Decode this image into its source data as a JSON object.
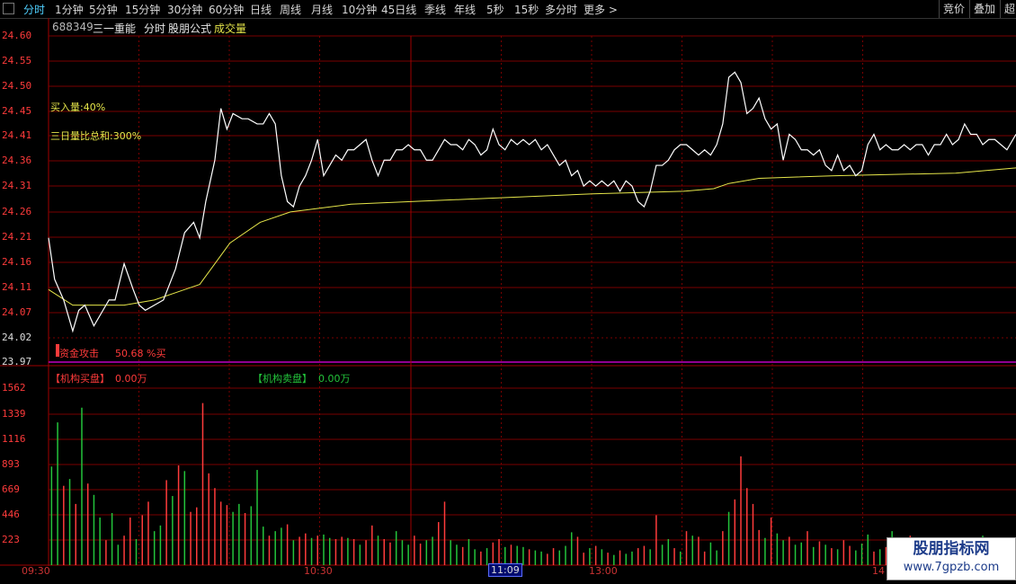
{
  "toolbar": {
    "periods": [
      "分时",
      "1分钟",
      "5分钟",
      "15分钟",
      "30分钟",
      "60分钟",
      "日线",
      "周线",
      "月线",
      "10分钟",
      "45日线",
      "季线",
      "年线",
      "5秒",
      "15秒",
      "多分时",
      "更多 >"
    ],
    "right_buttons": [
      "竞价",
      "叠加",
      "超"
    ]
  },
  "header": {
    "code": "688349",
    "name": "三一重能",
    "mode": "分时",
    "formula": "股朋公式",
    "volume_label": "成交量"
  },
  "indicators": {
    "buy_volume": "买入量:40%",
    "three_day_ratio": "三日量比总和:300%",
    "capital_attack_label": "资金攻击",
    "capital_attack_value": "50.68 %买",
    "inst_buy_label": "【机构买盘】",
    "inst_buy_value": "0.00万",
    "inst_sell_label": "【机构卖盘】",
    "inst_sell_value": "0.00万"
  },
  "time_labels": [
    "09:30",
    "10:30",
    "11:09",
    "13:00",
    "14"
  ],
  "watermark": {
    "title": "股朋指标网",
    "url": "www.7gpzb.com"
  },
  "colors": {
    "up": "#ff3b3b",
    "down": "#23c43b",
    "price": "#ffffff",
    "avg": "#e6e64a",
    "grid": "#7a0000",
    "accent": "#4fd0ff"
  },
  "chart_data": {
    "type": "line",
    "price_axis_labels": [
      "24.60",
      "24.55",
      "24.50",
      "24.45",
      "24.41",
      "24.36",
      "24.31",
      "24.26",
      "24.21",
      "24.16",
      "24.11",
      "24.07",
      "24.02",
      "23.97"
    ],
    "volume_axis_labels": [
      "1562",
      "1339",
      "1116",
      "893",
      "669",
      "446",
      "223"
    ],
    "ylim": [
      23.97,
      24.6
    ],
    "price": [
      [
        0,
        24.21
      ],
      [
        2,
        24.13
      ],
      [
        5,
        24.09
      ],
      [
        8,
        24.03
      ],
      [
        10,
        24.07
      ],
      [
        12,
        24.08
      ],
      [
        15,
        24.04
      ],
      [
        18,
        24.07
      ],
      [
        20,
        24.09
      ],
      [
        22,
        24.09
      ],
      [
        25,
        24.16
      ],
      [
        28,
        24.11
      ],
      [
        30,
        24.08
      ],
      [
        32,
        24.07
      ],
      [
        35,
        24.08
      ],
      [
        38,
        24.09
      ],
      [
        40,
        24.12
      ],
      [
        42,
        24.15
      ],
      [
        45,
        24.22
      ],
      [
        48,
        24.24
      ],
      [
        50,
        24.21
      ],
      [
        52,
        24.28
      ],
      [
        55,
        24.36
      ],
      [
        57,
        24.46
      ],
      [
        59,
        24.42
      ],
      [
        61,
        24.45
      ],
      [
        64,
        24.44
      ],
      [
        66,
        24.44
      ],
      [
        69,
        24.43
      ],
      [
        71,
        24.43
      ],
      [
        73,
        24.45
      ],
      [
        75,
        24.43
      ],
      [
        77,
        24.33
      ],
      [
        79,
        24.28
      ],
      [
        81,
        24.27
      ],
      [
        83,
        24.31
      ],
      [
        85,
        24.33
      ],
      [
        87,
        24.36
      ],
      [
        89,
        24.4
      ],
      [
        91,
        24.33
      ],
      [
        93,
        24.35
      ],
      [
        95,
        24.37
      ],
      [
        97,
        24.36
      ],
      [
        99,
        24.38
      ],
      [
        101,
        24.38
      ],
      [
        103,
        24.39
      ],
      [
        105,
        24.4
      ],
      [
        107,
        24.36
      ],
      [
        109,
        24.33
      ],
      [
        111,
        24.36
      ],
      [
        113,
        24.36
      ],
      [
        115,
        24.38
      ],
      [
        117,
        24.38
      ],
      [
        119,
        24.39
      ],
      [
        121,
        24.38
      ],
      [
        123,
        24.38
      ],
      [
        125,
        24.36
      ],
      [
        127,
        24.36
      ],
      [
        129,
        24.38
      ],
      [
        131,
        24.4
      ],
      [
        133,
        24.39
      ],
      [
        135,
        24.39
      ],
      [
        137,
        24.38
      ],
      [
        139,
        24.4
      ],
      [
        141,
        24.39
      ],
      [
        143,
        24.37
      ],
      [
        145,
        24.38
      ],
      [
        147,
        24.42
      ],
      [
        149,
        24.39
      ],
      [
        151,
        24.38
      ],
      [
        153,
        24.4
      ],
      [
        155,
        24.39
      ],
      [
        157,
        24.4
      ],
      [
        159,
        24.39
      ],
      [
        161,
        24.4
      ],
      [
        163,
        24.38
      ],
      [
        165,
        24.39
      ],
      [
        167,
        24.37
      ],
      [
        169,
        24.35
      ],
      [
        171,
        24.36
      ],
      [
        173,
        24.33
      ],
      [
        175,
        24.34
      ],
      [
        177,
        24.31
      ],
      [
        179,
        24.32
      ],
      [
        181,
        24.31
      ],
      [
        183,
        24.32
      ],
      [
        185,
        24.31
      ],
      [
        187,
        24.32
      ],
      [
        189,
        24.3
      ],
      [
        191,
        24.32
      ],
      [
        193,
        24.31
      ],
      [
        195,
        24.28
      ],
      [
        197,
        24.27
      ],
      [
        199,
        24.3
      ],
      [
        201,
        24.35
      ],
      [
        203,
        24.35
      ],
      [
        205,
        24.36
      ],
      [
        207,
        24.38
      ],
      [
        209,
        24.39
      ],
      [
        211,
        24.39
      ],
      [
        213,
        24.38
      ],
      [
        215,
        24.37
      ],
      [
        217,
        24.38
      ],
      [
        219,
        24.37
      ],
      [
        221,
        24.39
      ],
      [
        223,
        24.43
      ],
      [
        225,
        24.52
      ],
      [
        227,
        24.53
      ],
      [
        229,
        24.51
      ],
      [
        231,
        24.45
      ],
      [
        233,
        24.46
      ],
      [
        235,
        24.48
      ],
      [
        237,
        24.44
      ],
      [
        239,
        24.42
      ],
      [
        241,
        24.43
      ],
      [
        243,
        24.36
      ],
      [
        245,
        24.41
      ],
      [
        247,
        24.4
      ],
      [
        249,
        24.38
      ],
      [
        251,
        24.38
      ],
      [
        253,
        24.37
      ],
      [
        255,
        24.38
      ],
      [
        257,
        24.35
      ],
      [
        259,
        24.34
      ],
      [
        261,
        24.37
      ],
      [
        263,
        24.34
      ],
      [
        265,
        24.35
      ],
      [
        267,
        24.33
      ],
      [
        269,
        24.34
      ],
      [
        271,
        24.39
      ],
      [
        273,
        24.41
      ],
      [
        275,
        24.38
      ],
      [
        277,
        24.39
      ],
      [
        279,
        24.38
      ],
      [
        281,
        24.38
      ],
      [
        283,
        24.39
      ],
      [
        285,
        24.38
      ],
      [
        287,
        24.39
      ],
      [
        289,
        24.39
      ],
      [
        291,
        24.37
      ],
      [
        293,
        24.39
      ],
      [
        295,
        24.39
      ],
      [
        297,
        24.41
      ],
      [
        299,
        24.39
      ],
      [
        301,
        24.4
      ],
      [
        303,
        24.43
      ],
      [
        305,
        24.41
      ],
      [
        307,
        24.41
      ],
      [
        309,
        24.39
      ],
      [
        311,
        24.4
      ],
      [
        313,
        24.4
      ],
      [
        315,
        24.39
      ],
      [
        317,
        24.38
      ],
      [
        320,
        24.41
      ]
    ],
    "avg_price": [
      [
        0,
        24.11
      ],
      [
        8,
        24.08
      ],
      [
        15,
        24.08
      ],
      [
        25,
        24.08
      ],
      [
        35,
        24.09
      ],
      [
        45,
        24.11
      ],
      [
        50,
        24.12
      ],
      [
        55,
        24.16
      ],
      [
        60,
        24.2
      ],
      [
        70,
        24.24
      ],
      [
        80,
        24.26
      ],
      [
        100,
        24.275
      ],
      [
        140,
        24.285
      ],
      [
        180,
        24.295
      ],
      [
        210,
        24.3
      ],
      [
        220,
        24.305
      ],
      [
        225,
        24.315
      ],
      [
        235,
        24.325
      ],
      [
        260,
        24.33
      ],
      [
        300,
        24.335
      ],
      [
        320,
        24.345
      ]
    ],
    "volume": [
      [
        1,
        870,
        "down"
      ],
      [
        3,
        1260,
        "down"
      ],
      [
        5,
        700,
        "up"
      ],
      [
        7,
        760,
        "down"
      ],
      [
        9,
        540,
        "up"
      ],
      [
        11,
        1390,
        "down"
      ],
      [
        13,
        720,
        "up"
      ],
      [
        15,
        620,
        "down"
      ],
      [
        17,
        420,
        "down"
      ],
      [
        19,
        220,
        "up"
      ],
      [
        21,
        460,
        "down"
      ],
      [
        23,
        180,
        "down"
      ],
      [
        25,
        260,
        "up"
      ],
      [
        27,
        420,
        "up"
      ],
      [
        29,
        230,
        "down"
      ],
      [
        31,
        440,
        "up"
      ],
      [
        33,
        560,
        "up"
      ],
      [
        35,
        300,
        "down"
      ],
      [
        37,
        350,
        "down"
      ],
      [
        39,
        750,
        "up"
      ],
      [
        41,
        610,
        "down"
      ],
      [
        43,
        880,
        "up"
      ],
      [
        45,
        830,
        "down"
      ],
      [
        47,
        470,
        "up"
      ],
      [
        49,
        510,
        "up"
      ],
      [
        51,
        1430,
        "up"
      ],
      [
        53,
        810,
        "up"
      ],
      [
        55,
        680,
        "up"
      ],
      [
        57,
        560,
        "up"
      ],
      [
        59,
        530,
        "up"
      ],
      [
        61,
        470,
        "down"
      ],
      [
        63,
        540,
        "down"
      ],
      [
        65,
        460,
        "up"
      ],
      [
        67,
        520,
        "down"
      ],
      [
        69,
        840,
        "down"
      ],
      [
        71,
        340,
        "down"
      ],
      [
        73,
        260,
        "up"
      ],
      [
        75,
        300,
        "down"
      ],
      [
        77,
        330,
        "down"
      ],
      [
        79,
        360,
        "up"
      ],
      [
        81,
        220,
        "down"
      ],
      [
        83,
        250,
        "up"
      ],
      [
        85,
        280,
        "up"
      ],
      [
        87,
        240,
        "down"
      ],
      [
        89,
        260,
        "up"
      ],
      [
        91,
        270,
        "down"
      ],
      [
        93,
        240,
        "down"
      ],
      [
        95,
        230,
        "up"
      ],
      [
        97,
        250,
        "up"
      ],
      [
        99,
        240,
        "down"
      ],
      [
        101,
        230,
        "up"
      ],
      [
        103,
        180,
        "down"
      ],
      [
        105,
        220,
        "up"
      ],
      [
        107,
        350,
        "up"
      ],
      [
        109,
        260,
        "down"
      ],
      [
        111,
        230,
        "up"
      ],
      [
        113,
        200,
        "up"
      ],
      [
        115,
        300,
        "down"
      ],
      [
        117,
        220,
        "down"
      ],
      [
        119,
        180,
        "down"
      ],
      [
        121,
        260,
        "up"
      ],
      [
        123,
        190,
        "up"
      ],
      [
        125,
        220,
        "down"
      ],
      [
        127,
        250,
        "down"
      ],
      [
        129,
        380,
        "up"
      ],
      [
        131,
        560,
        "up"
      ],
      [
        133,
        220,
        "down"
      ],
      [
        135,
        180,
        "down"
      ],
      [
        137,
        160,
        "up"
      ],
      [
        139,
        230,
        "down"
      ],
      [
        141,
        140,
        "down"
      ],
      [
        143,
        120,
        "up"
      ],
      [
        145,
        150,
        "down"
      ],
      [
        147,
        200,
        "up"
      ],
      [
        149,
        230,
        "up"
      ],
      [
        151,
        160,
        "down"
      ],
      [
        153,
        180,
        "up"
      ],
      [
        155,
        170,
        "down"
      ],
      [
        157,
        160,
        "down"
      ],
      [
        159,
        140,
        "up"
      ],
      [
        161,
        130,
        "down"
      ],
      [
        163,
        120,
        "down"
      ],
      [
        165,
        100,
        "up"
      ],
      [
        167,
        150,
        "up"
      ],
      [
        169,
        130,
        "down"
      ],
      [
        171,
        170,
        "down"
      ],
      [
        173,
        290,
        "down"
      ],
      [
        175,
        250,
        "up"
      ],
      [
        177,
        110,
        "up"
      ],
      [
        179,
        150,
        "down"
      ],
      [
        181,
        170,
        "up"
      ],
      [
        183,
        140,
        "down"
      ],
      [
        185,
        110,
        "up"
      ],
      [
        187,
        90,
        "down"
      ],
      [
        189,
        130,
        "up"
      ],
      [
        191,
        100,
        "down"
      ],
      [
        193,
        120,
        "down"
      ],
      [
        195,
        150,
        "up"
      ],
      [
        197,
        170,
        "up"
      ],
      [
        199,
        140,
        "down"
      ],
      [
        201,
        440,
        "up"
      ],
      [
        203,
        180,
        "down"
      ],
      [
        205,
        230,
        "down"
      ],
      [
        207,
        150,
        "up"
      ],
      [
        209,
        120,
        "down"
      ],
      [
        211,
        300,
        "up"
      ],
      [
        213,
        260,
        "down"
      ],
      [
        215,
        250,
        "up"
      ],
      [
        217,
        120,
        "up"
      ],
      [
        219,
        200,
        "down"
      ],
      [
        221,
        130,
        "down"
      ],
      [
        223,
        300,
        "up"
      ],
      [
        225,
        470,
        "down"
      ],
      [
        227,
        580,
        "up"
      ],
      [
        229,
        960,
        "up"
      ],
      [
        231,
        680,
        "up"
      ],
      [
        233,
        540,
        "up"
      ],
      [
        235,
        310,
        "up"
      ],
      [
        237,
        240,
        "down"
      ],
      [
        239,
        420,
        "up"
      ],
      [
        241,
        280,
        "down"
      ],
      [
        243,
        220,
        "down"
      ],
      [
        245,
        250,
        "up"
      ],
      [
        247,
        180,
        "down"
      ],
      [
        249,
        200,
        "down"
      ],
      [
        251,
        300,
        "up"
      ],
      [
        253,
        160,
        "down"
      ],
      [
        255,
        210,
        "up"
      ],
      [
        257,
        180,
        "down"
      ],
      [
        259,
        150,
        "up"
      ],
      [
        261,
        140,
        "down"
      ],
      [
        263,
        220,
        "up"
      ],
      [
        265,
        170,
        "up"
      ],
      [
        267,
        130,
        "down"
      ],
      [
        269,
        190,
        "down"
      ],
      [
        271,
        270,
        "down"
      ],
      [
        273,
        120,
        "up"
      ],
      [
        275,
        140,
        "down"
      ],
      [
        277,
        160,
        "up"
      ],
      [
        279,
        300,
        "down"
      ],
      [
        281,
        200,
        "up"
      ],
      [
        283,
        180,
        "down"
      ],
      [
        285,
        260,
        "up"
      ],
      [
        287,
        220,
        "down"
      ],
      [
        289,
        130,
        "down"
      ],
      [
        291,
        150,
        "up"
      ],
      [
        293,
        240,
        "down"
      ],
      [
        295,
        180,
        "up"
      ],
      [
        297,
        100,
        "down"
      ],
      [
        299,
        130,
        "up"
      ],
      [
        301,
        160,
        "up"
      ],
      [
        303,
        200,
        "down"
      ],
      [
        305,
        120,
        "up"
      ],
      [
        307,
        110,
        "down"
      ],
      [
        309,
        260,
        "down"
      ],
      [
        311,
        150,
        "up"
      ],
      [
        313,
        190,
        "down"
      ],
      [
        315,
        220,
        "up"
      ],
      [
        317,
        160,
        "up"
      ],
      [
        319,
        200,
        "down"
      ]
    ]
  }
}
